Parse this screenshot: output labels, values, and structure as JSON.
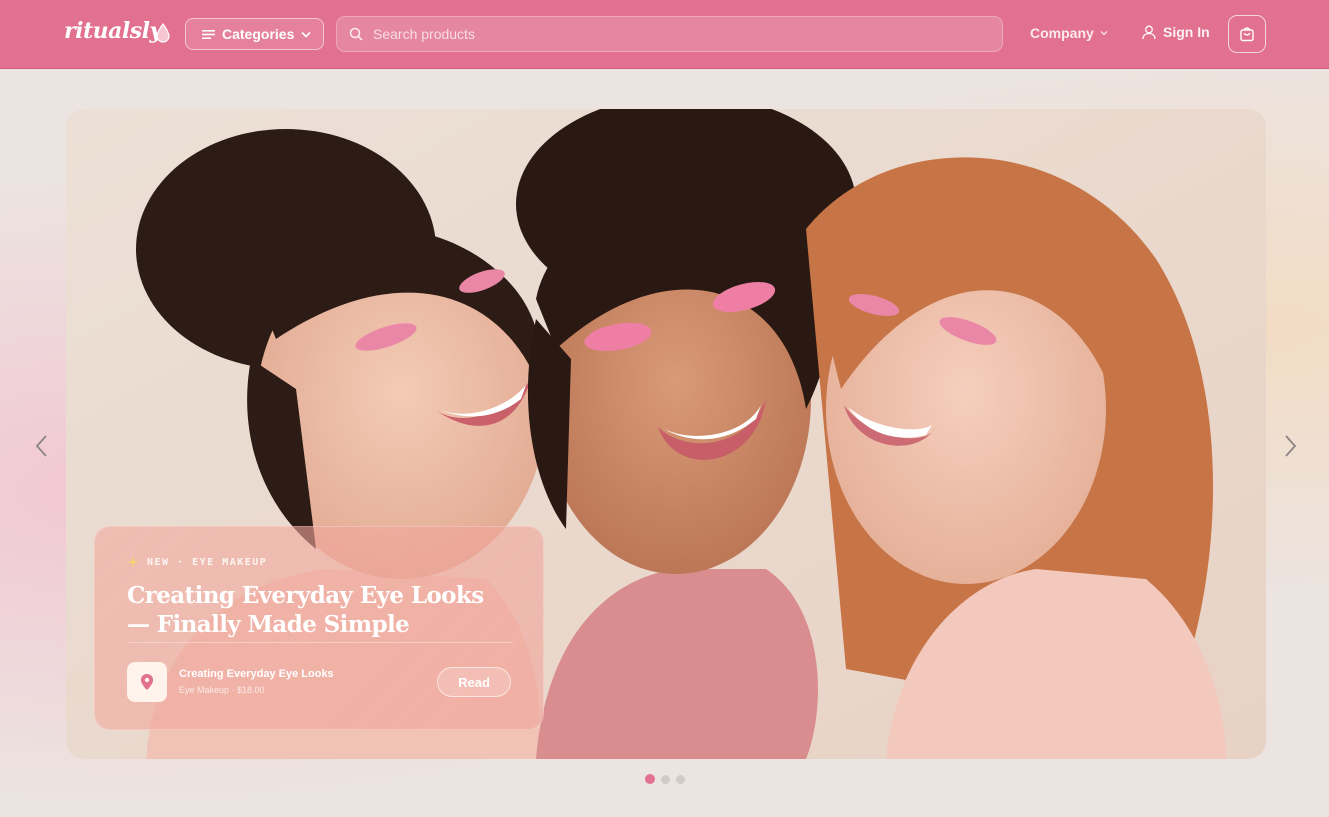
{
  "header": {
    "logo_text": "ritualsly",
    "categories_label": "Categories",
    "search_placeholder": "Search products",
    "company_label": "Company",
    "signin_label": "Sign In",
    "brand_color": "#e2708f"
  },
  "hero": {
    "image_alt": "Three smiling women wearing pink eye makeup",
    "tag": "NEW · EYE MAKEUP",
    "title": "Creating Everyday Eye Looks — Finally Made Simple",
    "product": {
      "name": "Creating Everyday Eye Looks",
      "meta": "Eye Makeup · $18.00"
    },
    "read_label": "Read"
  },
  "carousel": {
    "total_slides": 3,
    "active_slide": 1
  },
  "icons": {
    "menu": "menu-icon",
    "search": "search-icon",
    "user": "user-icon",
    "cart": "shopping-bag-icon",
    "prev": "chevron-left-icon",
    "next": "chevron-right-icon",
    "pin": "map-pin-icon",
    "sparkle": "sparkle-icon"
  }
}
